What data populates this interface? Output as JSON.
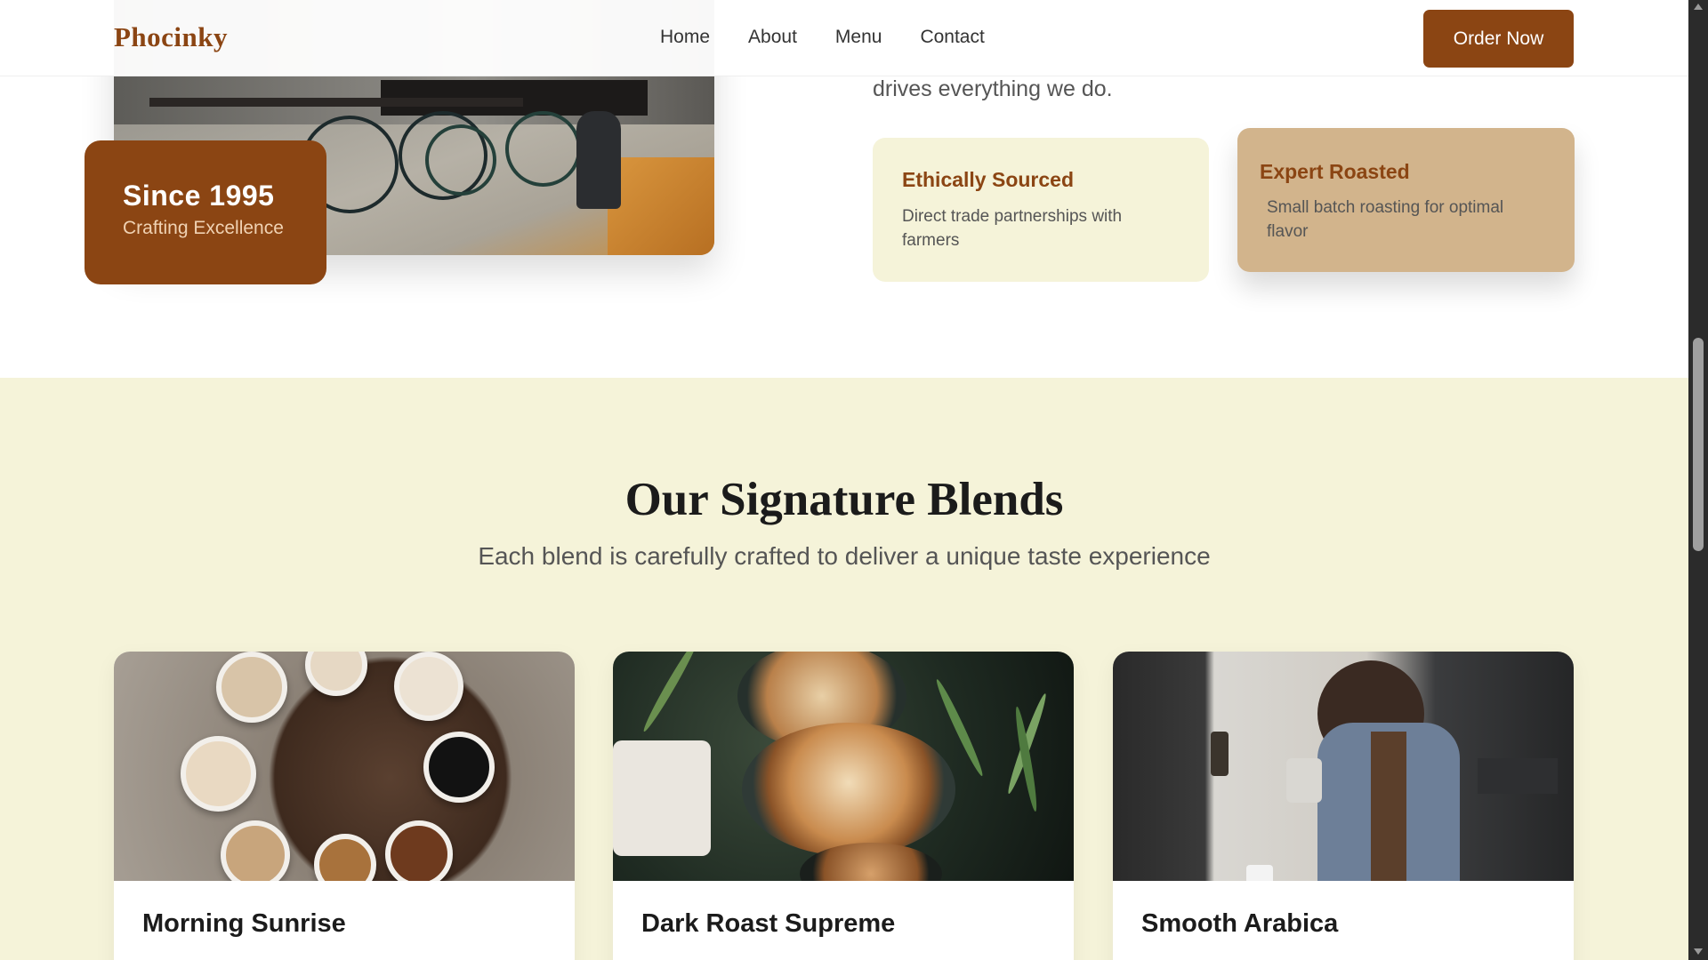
{
  "brand": {
    "name": "Phocinky",
    "accent": "#8b4513",
    "cream": "#f5f3d9",
    "tan": "#d2b48c"
  },
  "nav": {
    "links": [
      "Home",
      "About",
      "Menu",
      "Contact"
    ],
    "cta_label": "Order Now"
  },
  "about": {
    "text_tail": "drives everything we do.",
    "badge": {
      "title": "Since 1995",
      "subtitle": "Crafting Excellence"
    },
    "features": [
      {
        "title": "Ethically Sourced",
        "description": "Direct trade partnerships with farmers"
      },
      {
        "title": "Expert Roasted",
        "description": "Small batch roasting for optimal flavor"
      }
    ]
  },
  "blends": {
    "title": "Our Signature Blends",
    "subtitle": "Each blend is carefully crafted to deliver a unique taste experience",
    "cards": [
      {
        "name": "Morning Sunrise",
        "image": "coffee-cups-on-table-photo"
      },
      {
        "name": "Dark Roast Supreme",
        "image": "latte-art-photo"
      },
      {
        "name": "Smooth Arabica",
        "image": "barista-pouring-photo"
      }
    ]
  }
}
